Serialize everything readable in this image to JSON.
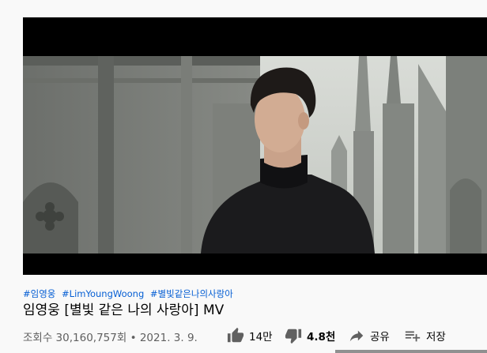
{
  "video": {
    "hashtags": [
      "#임영웅",
      "#LimYoungWoong",
      "#별빛같은나의사랑아"
    ],
    "title": "임영웅 [별빛 같은 나의 사랑아] MV",
    "views": "조회수 30,160,757회",
    "separator": "•",
    "date": "2021. 3. 9."
  },
  "actions": {
    "like_count": "14만",
    "dislike_count": "4.8천",
    "share_label": "공유",
    "save_label": "저장"
  },
  "colors": {
    "hashtag": "#065fd4",
    "meta_text": "#606060",
    "background": "#f9f9f9",
    "player_bg": "#000000",
    "like_bar": "#909090"
  },
  "icons": [
    "thumb-up-icon",
    "thumb-down-icon",
    "share-icon",
    "add-to-playlist-icon"
  ]
}
